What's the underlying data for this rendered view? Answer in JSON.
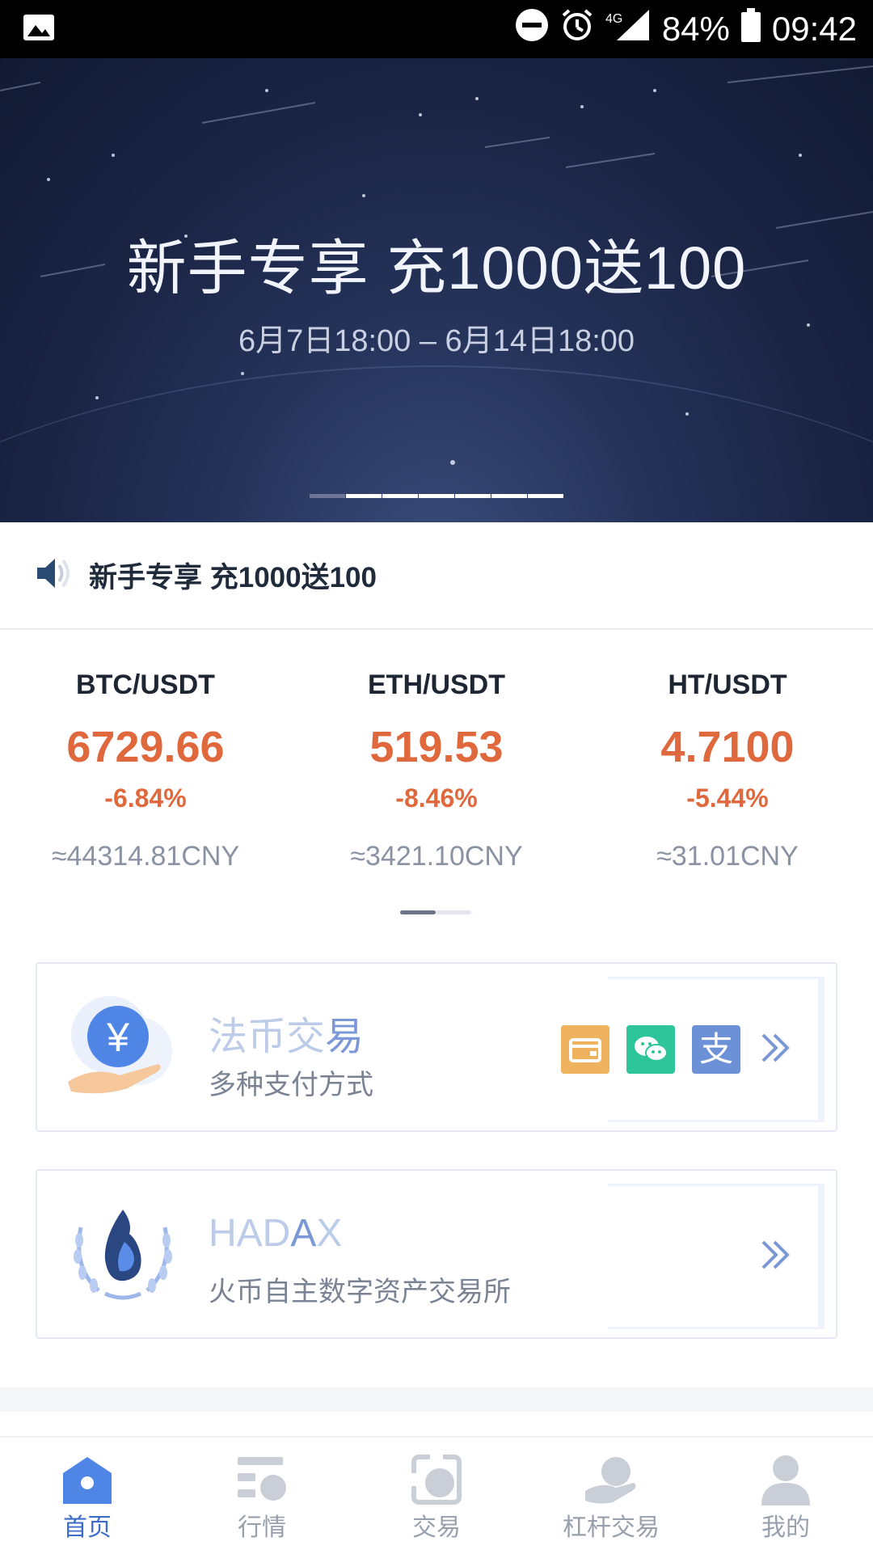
{
  "status_bar": {
    "battery": "84%",
    "time": "09:42",
    "network": "4G",
    "icons": [
      "image-icon",
      "dnd-icon",
      "alarm-icon",
      "signal-icon",
      "battery-icon"
    ]
  },
  "banner": {
    "title": "新手专享 充1000送100",
    "subtitle": "6月7日18:00 – 6月14日18:00",
    "slide_count": 7
  },
  "notice": {
    "icon": "speaker-icon",
    "text": "新手专享 充1000送100"
  },
  "tickers": [
    {
      "pair": "BTC/USDT",
      "price": "6729.66",
      "change": "-6.84%",
      "cny": "≈44314.81CNY"
    },
    {
      "pair": "ETH/USDT",
      "price": "519.53",
      "change": "-8.46%",
      "cny": "≈3421.10CNY"
    },
    {
      "pair": "HT/USDT",
      "price": "4.7100",
      "change": "-5.44%",
      "cny": "≈31.01CNY"
    }
  ],
  "cards": {
    "fiat": {
      "title_light": "法币交",
      "title_strong": "易",
      "subtitle": "多种支付方式",
      "payment_icons": [
        "bank-card-icon",
        "wechat-icon",
        "alipay-icon"
      ],
      "alipay_glyph": "支"
    },
    "hadax": {
      "title_light": "HAD",
      "title_strong": "A",
      "title_tail": "X",
      "subtitle": "火币自主数字资产交易所"
    }
  },
  "tabbar": [
    {
      "label": "首页",
      "active": true
    },
    {
      "label": "行情",
      "active": false
    },
    {
      "label": "交易",
      "active": false
    },
    {
      "label": "杠杆交易",
      "active": false
    },
    {
      "label": "我的",
      "active": false
    }
  ],
  "colors": {
    "accent": "#3d6cc9",
    "price_down": "#e0683d",
    "wechat": "#2fc59a",
    "card_payment": "#efb25f",
    "alipay": "#6c91d6"
  }
}
